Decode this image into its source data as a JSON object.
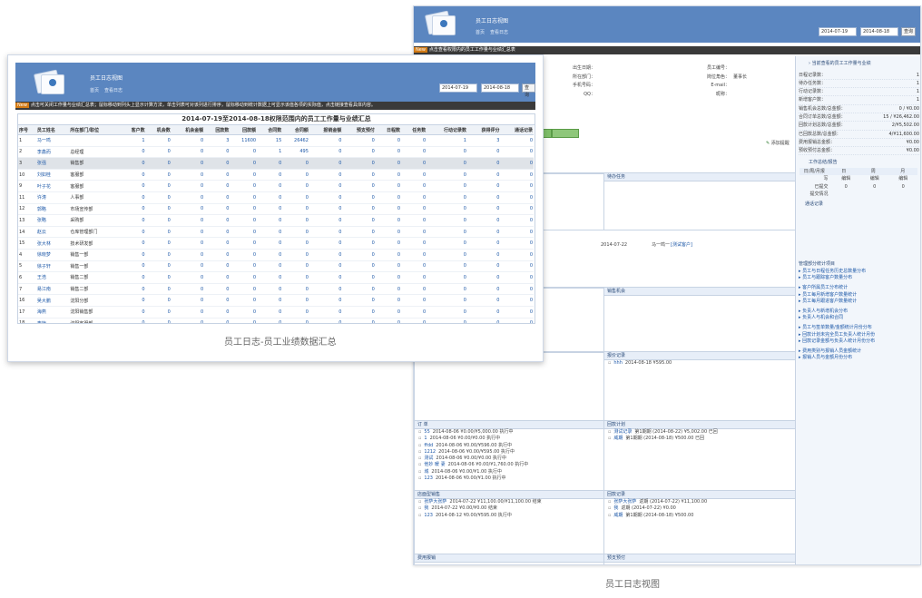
{
  "app": {
    "title": "员工日志视图",
    "nav": [
      "首页",
      "查看日志"
    ]
  },
  "dates": {
    "start": "2014-07-19",
    "end": "2014-08-18",
    "query": "查询"
  },
  "back": {
    "notice": "点击查看权限内的员工工作量与业绩汇总表",
    "profile_left": [
      {
        "label": "出生日期：",
        "value": ""
      },
      {
        "label": "所在部门：",
        "value": ""
      },
      {
        "label": "手机号码：",
        "value": ""
      },
      {
        "label": "QQ：",
        "value": ""
      }
    ],
    "profile_right": [
      {
        "label": "员工编号：",
        "value": ""
      },
      {
        "label": "岗位角色：",
        "value": "董事长"
      },
      {
        "label": "E-mail：",
        "value": ""
      },
      {
        "label": "昵称：",
        "value": ""
      }
    ],
    "green_buttons": [
      "",
      ""
    ],
    "add_log": "添加提醒",
    "panels": {
      "left1": "",
      "right1": "待办任务",
      "row_date": "2014-07-22",
      "row_text": "马一鸣一",
      "row_link": "[测试客户]",
      "left2": "",
      "right2": "销售机会",
      "left3": "",
      "right3": "报价记录",
      "left3_rows": [
        {
          "no": "818",
          "text": "2014-08-18  ¥5.00/¥222.00 执行中"
        }
      ],
      "right3_rows": [
        {
          "no": "hhh",
          "text": "2014-08-18  ¥595.00"
        }
      ],
      "orders_title": "订 单",
      "orders": [
        {
          "no": "55",
          "text": "2014-08-06  ¥0.00/¥5,000.00 执行中"
        },
        {
          "no": "1",
          "text": "2014-08-06  ¥0.00/¥0.00 执行中"
        },
        {
          "no": "ffdd",
          "text": "2014-08-06  ¥0.00/¥596.00 执行中"
        },
        {
          "no": "1212",
          "text": "2014-08-06  ¥0.00/¥595.00 执行中"
        },
        {
          "no": "测试",
          "text": "2014-08-06  ¥0.00/¥0.00 执行中"
        },
        {
          "no": "他妙 暖 妻",
          "text": "2014-08-06  ¥0.00/¥1,760.00 执行中"
        },
        {
          "no": "城",
          "text": "2014-08-06  ¥0.00/¥1.00 执行中"
        },
        {
          "no": "123",
          "text": "2014-08-06  ¥0.00/¥1.00 执行中"
        }
      ],
      "plan_title": "回款计划",
      "plans": [
        {
          "no": "测试记录",
          "text": "第1期期 (2014-08-22)  ¥5,002.00  已回"
        },
        {
          "no": "威期",
          "text": "第1期期 (2014-08-18)  ¥500.00  已回"
        }
      ],
      "sales_title": "店面型销售",
      "sales": [
        {
          "no": "张萨大张萨",
          "text": "2014-07-22  ¥11,100.00/¥11,100.00 结束"
        },
        {
          "no": "我",
          "text": "2014-07-22  ¥0.00/¥0.00 结束"
        },
        {
          "no": "123",
          "text": "2014-08-12  ¥0.00/¥595.00 执行中"
        }
      ],
      "refund_title": "回款记录",
      "refunds": [
        {
          "no": "张萨大张萨",
          "text": "返期 (2014-07-22)  ¥11,100.00"
        },
        {
          "no": "我",
          "text": "返期 (2014-07-22)  ¥0.00"
        },
        {
          "no": "威期",
          "text": "第1期期 (2014-08-18)  ¥500.00"
        }
      ],
      "bottom_left": "费用报销",
      "bottom_right": "预支预付"
    },
    "sidebar": {
      "title": "当前查看的员工工作量与业绩",
      "stats": [
        {
          "label": "日程记录数：",
          "value": "1"
        },
        {
          "label": "待办任务数：",
          "value": "1"
        },
        {
          "label": "行动记录数：",
          "value": "1"
        },
        {
          "label": "新增客户数：",
          "value": "1"
        },
        {
          "label": "销售机会总数/总金额：",
          "value": "0 / ¥0.00"
        },
        {
          "label": "合同订单总数/总金额：",
          "value": "15 / ¥26,462.00"
        },
        {
          "label": "回款计划总数/总金额：",
          "value": "2/¥5,502.00"
        },
        {
          "label": "已回款总数/总金额：",
          "value": "4/¥11,600.00"
        },
        {
          "label": "费用报销总金额：",
          "value": "¥0.00"
        },
        {
          "label": "预收预付总金额：",
          "value": "¥0.00"
        }
      ],
      "work_title": "工作总结/报告",
      "work_cols": [
        "日/周/月报",
        "日",
        "周",
        "月"
      ],
      "work_rows": [
        {
          "label": "写",
          "vals": [
            "编辑",
            "编辑",
            "编辑"
          ]
        },
        {
          "label": "已提交",
          "vals": [
            "0",
            "0",
            "0"
          ]
        },
        {
          "label": "提交情况",
          "vals": [
            "",
            "",
            ""
          ]
        }
      ],
      "comm_title": "通话记录",
      "links_title": "管理部分统计项目",
      "links": [
        "员工与日程任务历史总数量分布",
        "员工与跟踪客户数量分布",
        "客户所属员工分布统计",
        "员工每月新增客户数量统计",
        "员工每月跟进客户数量统计",
        "负责人与新增机会分布",
        "负责人与机会和合同",
        "员工与签单数量/金额统计月份分布",
        "回款计划未完全员工负责人统计月份",
        "回款记录金额与负责人统计月份分布",
        "费用类别与报销人员金额统计",
        "报销人员与金额月份分布"
      ]
    }
  },
  "front": {
    "notice": "点击可关闭工作量与业绩汇总表；鼠标移动到列头上显示计算方法，单击列表可对该列进行排序，鼠标移动到统计数据上可显示该值各项的实际值，点击链接查看具体内容。",
    "table_title": "2014-07-19至2014-08-18权限范围内的员工工作量与业绩汇总",
    "columns": [
      "序号",
      "员工姓名",
      "所在部门/职位",
      "客户数",
      "机会数",
      "机会金额",
      "回款数",
      "回款额",
      "合同数",
      "合同额",
      "报销金额",
      "预支预付",
      "日程数",
      "任务数",
      "行动记录数",
      "获得评分",
      "通话记录"
    ],
    "rows": [
      {
        "no": "1",
        "name": "马一鸣",
        "dept": "",
        "vals": [
          "1",
          "0",
          "0",
          "3",
          "11600",
          "15",
          "26462",
          "0",
          "0",
          "0",
          "0",
          "1",
          "3",
          "0"
        ]
      },
      {
        "no": "2",
        "name": "李鑫而",
        "dept": "总经理",
        "vals": [
          "0",
          "0",
          "0",
          "0",
          "0",
          "1",
          "495",
          "0",
          "0",
          "0",
          "0",
          "0",
          "0",
          "0"
        ]
      },
      {
        "no": "3",
        "name": "张强",
        "dept": "销售部",
        "vals": [
          "0",
          "0",
          "0",
          "0",
          "0",
          "0",
          "0",
          "0",
          "0",
          "0",
          "0",
          "0",
          "0",
          "0"
        ]
      },
      {
        "no": "10",
        "name": "刘如桂",
        "dept": "客服部",
        "vals": [
          "0",
          "0",
          "0",
          "0",
          "0",
          "0",
          "0",
          "0",
          "0",
          "0",
          "0",
          "0",
          "0",
          "0"
        ]
      },
      {
        "no": "9",
        "name": "叶子花",
        "dept": "客服部",
        "vals": [
          "0",
          "0",
          "0",
          "0",
          "0",
          "0",
          "0",
          "0",
          "0",
          "0",
          "0",
          "0",
          "0",
          "0"
        ]
      },
      {
        "no": "11",
        "name": "许涛",
        "dept": "人事部",
        "vals": [
          "0",
          "0",
          "0",
          "0",
          "0",
          "0",
          "0",
          "0",
          "0",
          "0",
          "0",
          "0",
          "0",
          "0"
        ]
      },
      {
        "no": "12",
        "name": "郭略",
        "dept": "市场宣传部",
        "vals": [
          "0",
          "0",
          "0",
          "0",
          "0",
          "0",
          "0",
          "0",
          "0",
          "0",
          "0",
          "0",
          "0",
          "0"
        ]
      },
      {
        "no": "13",
        "name": "张略",
        "dept": "采购部",
        "vals": [
          "0",
          "0",
          "0",
          "0",
          "0",
          "0",
          "0",
          "0",
          "0",
          "0",
          "0",
          "0",
          "0",
          "0"
        ]
      },
      {
        "no": "14",
        "name": "赵云",
        "dept": "仓库管理部门",
        "vals": [
          "0",
          "0",
          "0",
          "0",
          "0",
          "0",
          "0",
          "0",
          "0",
          "0",
          "0",
          "0",
          "0",
          "0"
        ]
      },
      {
        "no": "15",
        "name": "张大林",
        "dept": "技术研发部",
        "vals": [
          "0",
          "0",
          "0",
          "0",
          "0",
          "0",
          "0",
          "0",
          "0",
          "0",
          "0",
          "0",
          "0",
          "0"
        ]
      },
      {
        "no": "4",
        "name": "徐晓梦",
        "dept": "销售一部",
        "vals": [
          "0",
          "0",
          "0",
          "0",
          "0",
          "0",
          "0",
          "0",
          "0",
          "0",
          "0",
          "0",
          "0",
          "0"
        ]
      },
      {
        "no": "5",
        "name": "徐子轩",
        "dept": "销售一部",
        "vals": [
          "0",
          "0",
          "0",
          "0",
          "0",
          "0",
          "0",
          "0",
          "0",
          "0",
          "0",
          "0",
          "0",
          "0"
        ]
      },
      {
        "no": "6",
        "name": "王浩",
        "dept": "销售二部",
        "vals": [
          "0",
          "0",
          "0",
          "0",
          "0",
          "0",
          "0",
          "0",
          "0",
          "0",
          "0",
          "0",
          "0",
          "0"
        ]
      },
      {
        "no": "7",
        "name": "易江南",
        "dept": "销售二部",
        "vals": [
          "0",
          "0",
          "0",
          "0",
          "0",
          "0",
          "0",
          "0",
          "0",
          "0",
          "0",
          "0",
          "0",
          "0"
        ]
      },
      {
        "no": "16",
        "name": "吴大鹏",
        "dept": "沈阳分部",
        "vals": [
          "0",
          "0",
          "0",
          "0",
          "0",
          "0",
          "0",
          "0",
          "0",
          "0",
          "0",
          "0",
          "0",
          "0"
        ]
      },
      {
        "no": "17",
        "name": "海燕",
        "dept": "沈阳销售部",
        "vals": [
          "0",
          "0",
          "0",
          "0",
          "0",
          "0",
          "0",
          "0",
          "0",
          "0",
          "0",
          "0",
          "0",
          "0"
        ]
      },
      {
        "no": "18",
        "name": "李梅",
        "dept": "沈阳客服部",
        "vals": [
          "0",
          "0",
          "0",
          "0",
          "0",
          "0",
          "0",
          "0",
          "0",
          "0",
          "0",
          "0",
          "0",
          "0"
        ]
      }
    ]
  },
  "captions": {
    "front": "员工日志-员工业绩数据汇总",
    "back": "员工日志视图"
  }
}
